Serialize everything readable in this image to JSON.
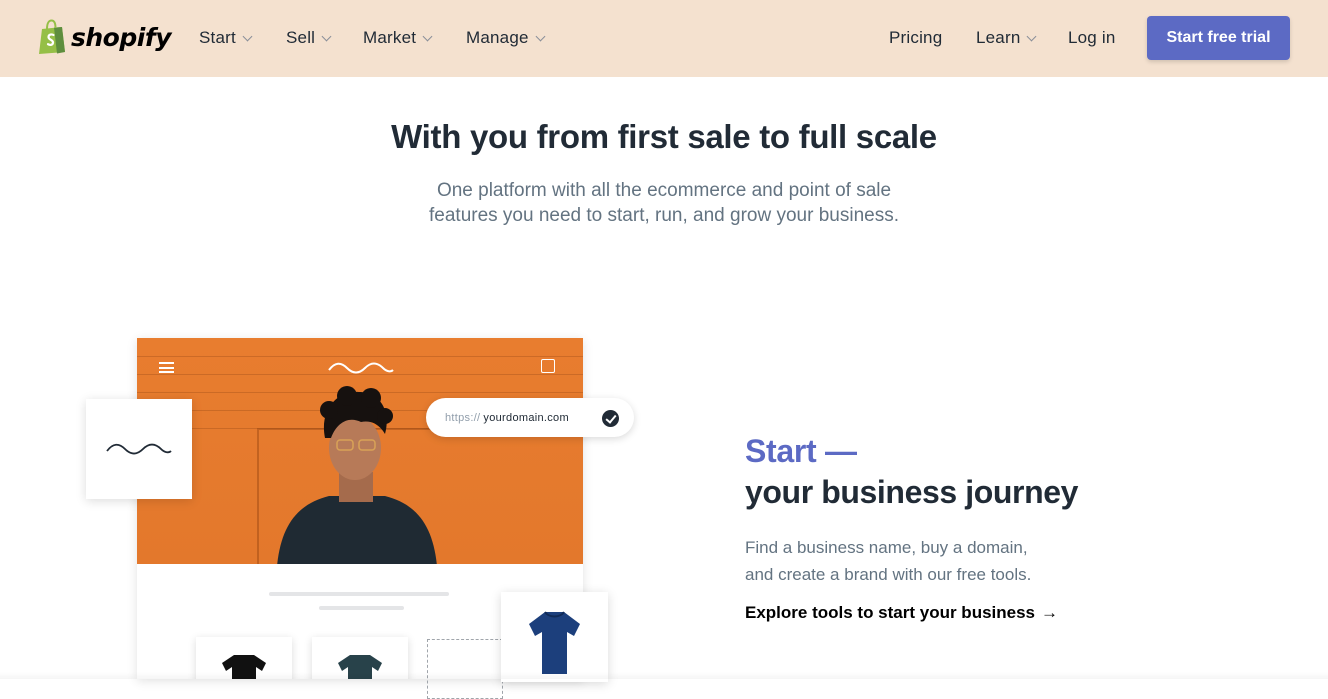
{
  "nav": {
    "brand": "shopify",
    "menu": [
      {
        "label": "Start"
      },
      {
        "label": "Sell"
      },
      {
        "label": "Market"
      },
      {
        "label": "Manage"
      }
    ],
    "right": {
      "pricing": "Pricing",
      "learn": "Learn",
      "login": "Log in",
      "cta": "Start free trial"
    }
  },
  "hero": {
    "title": "With you from first sale to full scale",
    "subtitle_line1": "One platform with all the ecommerce and point of sale",
    "subtitle_line2": "features you need to start, run, and grow your business."
  },
  "mockup": {
    "domain_prefix": "https://",
    "domain_name": "yourdomain.com"
  },
  "section": {
    "accent": "Start —",
    "title": "your business journey",
    "body_line1": "Find a business name, buy a domain,",
    "body_line2": "and create a brand with our free tools.",
    "link": "Explore tools to start your business",
    "link_arrow": "→"
  },
  "colors": {
    "nav_bg": "#f4e1cf",
    "accent": "#5c6ac4",
    "photo_bg": "#e87d2f",
    "text_dark": "#212b36",
    "text_muted": "#637381"
  }
}
